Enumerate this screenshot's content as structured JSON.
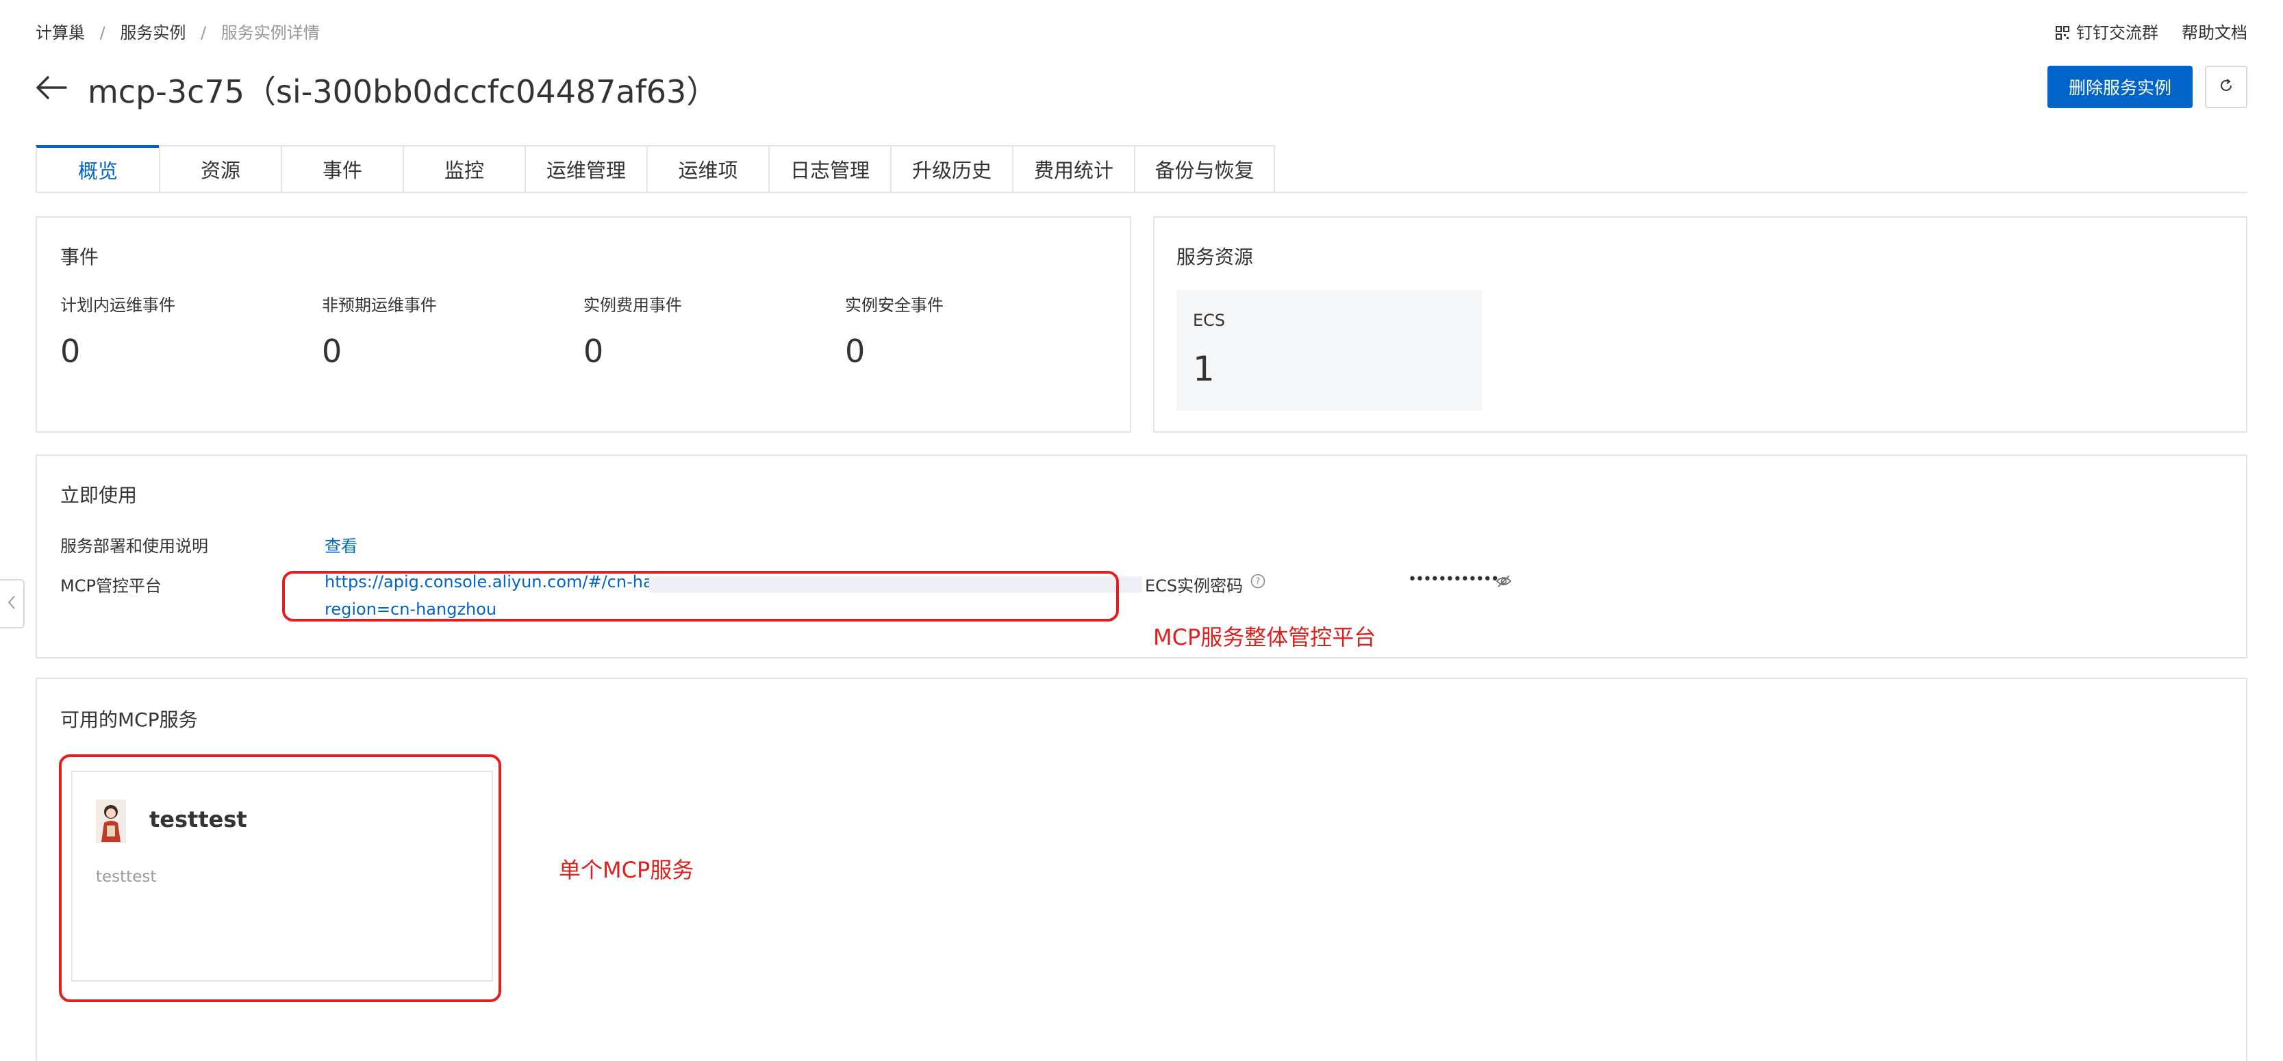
{
  "breadcrumb": {
    "items": [
      "计算巢",
      "服务实例",
      "服务实例详情"
    ],
    "sep": "/"
  },
  "top_links": {
    "dingtalk": "钉钉交流群",
    "help": "帮助文档"
  },
  "header": {
    "title": "mcp-3c75（si-300bb0dccfc04487af63）"
  },
  "actions": {
    "delete_label": "删除服务实例"
  },
  "tabs": [
    {
      "label": "概览",
      "active": true
    },
    {
      "label": "资源"
    },
    {
      "label": "事件"
    },
    {
      "label": "监控"
    },
    {
      "label": "运维管理"
    },
    {
      "label": "运维项"
    },
    {
      "label": "日志管理"
    },
    {
      "label": "升级历史"
    },
    {
      "label": "费用统计"
    },
    {
      "label": "备份与恢复"
    }
  ],
  "events": {
    "title": "事件",
    "items": [
      {
        "label": "计划内运维事件",
        "value": "0"
      },
      {
        "label": "非预期运维事件",
        "value": "0"
      },
      {
        "label": "实例费用事件",
        "value": "0"
      },
      {
        "label": "实例安全事件",
        "value": "0"
      }
    ]
  },
  "resources": {
    "title": "服务资源",
    "ecs_label": "ECS",
    "ecs_count": "1"
  },
  "use_now": {
    "title": "立即使用",
    "doc_label": "服务部署和使用说明",
    "doc_link": "查看",
    "mcp_label": "MCP管控平台",
    "mcp_url_line1": "https://apig.console.aliyun.com/#/cn-hang",
    "mcp_url_line2": "region=cn-hangzhou",
    "password_label": "ECS实例密码",
    "password_value": "••••••••••••"
  },
  "mcp_services": {
    "title": "可用的MCP服务",
    "items": [
      {
        "name": "testtest",
        "description": "testtest"
      }
    ]
  },
  "annotations": {
    "platform": "MCP服务整体管控平台",
    "single": "单个MCP服务"
  },
  "colors": {
    "accent": "#0064c8",
    "annotation": "#e0201f"
  }
}
